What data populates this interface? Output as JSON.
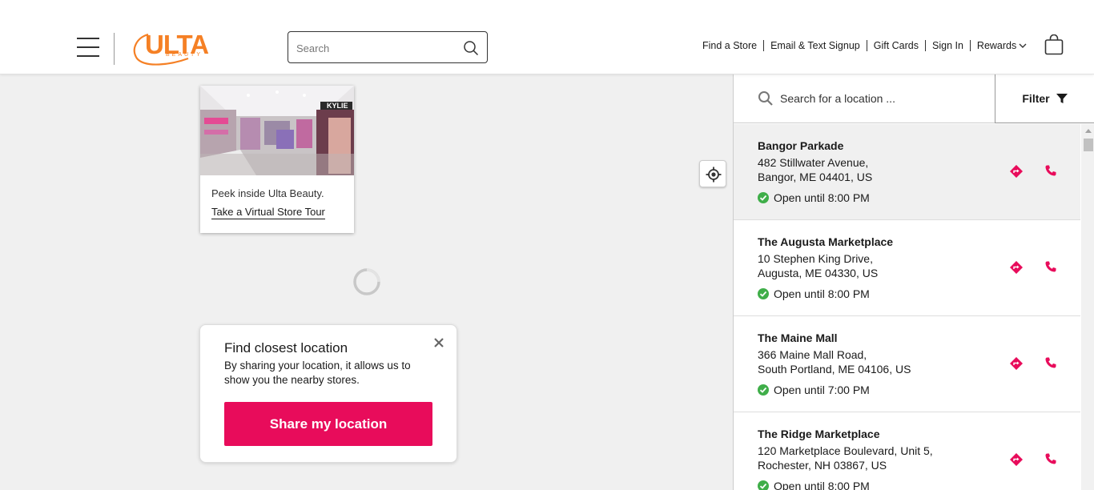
{
  "header": {
    "logo_text": "ULTA",
    "logo_sub": "BEAUTY",
    "search_placeholder": "Search",
    "nav": [
      "Find a Store",
      "Email & Text Signup",
      "Gift Cards",
      "Sign In"
    ],
    "rewards_label": "Rewards"
  },
  "map": {
    "tour_caption": "Peek inside Ulta Beauty.",
    "tour_link": "Take a Virtual Store Tour",
    "tour_sign": "KYLIE",
    "popup": {
      "title": "Find closest location",
      "body": "By sharing your location, it allows us to show you the nearby stores.",
      "button": "Share my location"
    }
  },
  "panel": {
    "search_placeholder": "Search for a location ...",
    "filter_label": "Filter",
    "stores": [
      {
        "name": "Bangor Parkade",
        "addr1": "482 Stillwater Avenue,",
        "addr2": "Bangor, ME 04401, US",
        "hours": "Open until 8:00 PM"
      },
      {
        "name": "The Augusta Marketplace",
        "addr1": "10 Stephen King Drive,",
        "addr2": "Augusta, ME 04330, US",
        "hours": "Open until 8:00 PM"
      },
      {
        "name": "The Maine Mall",
        "addr1": "366 Maine Mall Road,",
        "addr2": "South Portland, ME 04106, US",
        "hours": "Open until 7:00 PM"
      },
      {
        "name": "The Ridge Marketplace",
        "addr1": "120 Marketplace Boulevard, Unit 5,",
        "addr2": "Rochester, NH 03867, US",
        "hours": "Open until 8:00 PM"
      }
    ]
  },
  "colors": {
    "brand_orange": "#f58025",
    "accent_pink": "#e80c5b",
    "open_green": "#3fae49"
  }
}
